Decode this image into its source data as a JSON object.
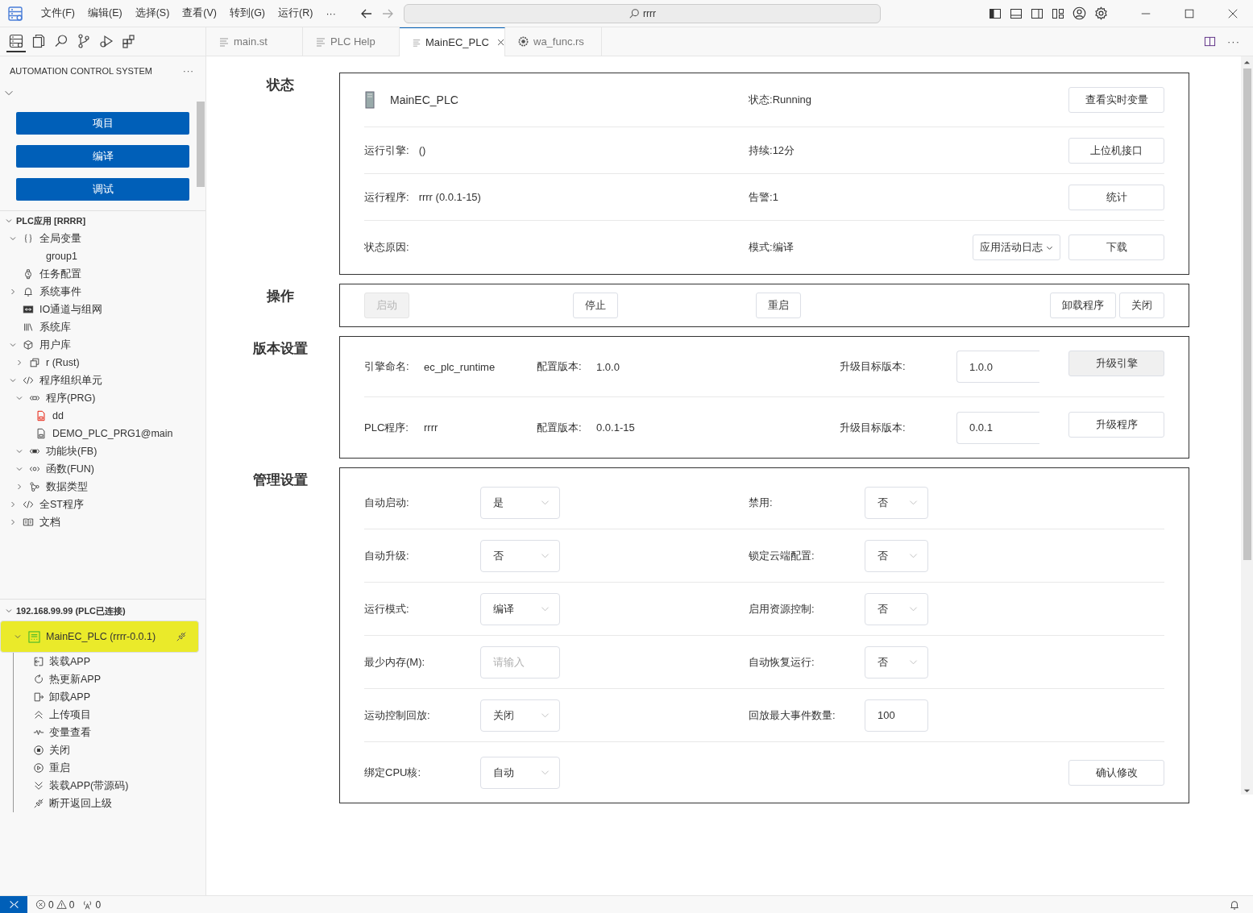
{
  "menu": [
    "文件(F)",
    "编辑(E)",
    "选择(S)",
    "查看(V)",
    "转到(G)",
    "运行(R)",
    "···"
  ],
  "search": {
    "value": "rrrr"
  },
  "activity_bar": [
    {
      "selected": true
    },
    {
      "selected": false
    },
    {
      "selected": false
    },
    {
      "selected": false
    },
    {
      "selected": false
    },
    {
      "selected": false
    }
  ],
  "tabs": [
    {
      "label": "main.st",
      "kind": "text",
      "selected": false
    },
    {
      "label": "PLC Help",
      "kind": "text",
      "selected": false
    },
    {
      "label": "MainEC_PLC",
      "kind": "text",
      "selected": true
    },
    {
      "label": "wa_func.rs",
      "kind": "rust",
      "selected": false
    }
  ],
  "editor_more": "···",
  "sidebar": {
    "title": "AUTOMATION CONTROL SYSTEM",
    "more": "···",
    "buttons": [
      "项目",
      "编译",
      "调试"
    ],
    "project": {
      "label": "PLC应用 [RRRR]",
      "expanded": true,
      "children": [
        {
          "label": "全局变量",
          "kind": "variables",
          "expandable": true,
          "expanded": true,
          "children": [
            {
              "label": "group1",
              "kind": "group",
              "expandable": false,
              "expanded": false
            }
          ]
        },
        {
          "label": "任务配置",
          "kind": "task",
          "expandable": false,
          "expanded": false
        },
        {
          "label": "系统事件",
          "kind": "events",
          "expandable": true,
          "expanded": false
        },
        {
          "label": "IO通道与组网",
          "kind": "io",
          "expandable": false,
          "expanded": false
        },
        {
          "label": "系统库",
          "kind": "library",
          "expandable": false,
          "expanded": false
        },
        {
          "label": "用户库",
          "kind": "package",
          "expandable": true,
          "expanded": true,
          "children": [
            {
              "label": "r (Rust)",
              "kind": "module",
              "expandable": true,
              "expanded": false
            }
          ]
        },
        {
          "label": "程序组织单元",
          "kind": "units",
          "expandable": true,
          "expanded": true,
          "children": [
            {
              "label": "程序(PRG)",
              "kind": "program",
              "expandable": true,
              "expanded": true,
              "children": [
                {
                  "label": "dd",
                  "kind": "ld",
                  "expandable": false,
                  "expanded": false
                },
                {
                  "label": "DEMO_PLC_PRG1@main",
                  "kind": "st",
                  "expandable": false,
                  "expanded": false
                }
              ]
            },
            {
              "label": "功能块(FB)",
              "kind": "fb",
              "expandable": true,
              "expanded": true
            },
            {
              "label": "函数(FUN)",
              "kind": "fc",
              "expandable": true,
              "expanded": true
            },
            {
              "label": "数据类型",
              "kind": "types",
              "expandable": true,
              "expanded": false
            }
          ]
        },
        {
          "label": "全ST程序",
          "kind": "units",
          "expandable": true,
          "expanded": false
        },
        {
          "label": "文档",
          "kind": "docs",
          "expandable": true,
          "expanded": false
        }
      ]
    },
    "connection": {
      "label": "192.168.99.99 (PLC已连接)",
      "expanded": true,
      "device": {
        "label": "MainEC_PLC (rrrr-0.0.1)",
        "selected": true,
        "expanded": true,
        "actions": [
          {
            "label": "装载APP",
            "kind": "load"
          },
          {
            "label": "热更新APP",
            "kind": "hot-update"
          },
          {
            "label": "卸载APP",
            "kind": "unload"
          },
          {
            "label": "上传项目",
            "kind": "upload"
          },
          {
            "label": "变量查看",
            "kind": "watch"
          },
          {
            "label": "关闭",
            "kind": "stop"
          },
          {
            "label": "重启",
            "kind": "restart"
          },
          {
            "label": "装载APP(带源码)",
            "kind": "load-source"
          },
          {
            "label": "断开返回上级",
            "kind": "disconnect"
          }
        ]
      }
    }
  },
  "status_panel": {
    "heading": "状态",
    "rows": [
      {
        "kind": "device",
        "label": "MainEC_PLC",
        "field_label": "状态:",
        "field_value": "Running",
        "buttons": [
          {
            "label": "查看实时变量",
            "kind": "button"
          }
        ]
      },
      {
        "kind": "info",
        "label": "运行引擎:",
        "value": "()",
        "field_label": "持续:",
        "field_value": "12分",
        "buttons": [
          {
            "label": "上位机接口",
            "kind": "button"
          }
        ]
      },
      {
        "kind": "info",
        "label": "运行程序:",
        "value": "rrrr (0.0.1-15)",
        "field_label": "告警:",
        "field_value": "1",
        "buttons": [
          {
            "label": "统计",
            "kind": "button"
          }
        ]
      },
      {
        "kind": "info",
        "label": "状态原因:",
        "field_label": "模式:",
        "field_value": "编译",
        "buttons": [
          {
            "label": "应用活动日志",
            "kind": "dropdown"
          },
          {
            "label": "下载",
            "kind": "button"
          }
        ]
      }
    ]
  },
  "operations": {
    "heading": "操作",
    "buttons": [
      {
        "label": "启动",
        "disabled": true
      },
      {
        "label": "停止",
        "disabled": false
      },
      {
        "label": "重启",
        "disabled": false
      },
      {
        "label": "卸载程序",
        "disabled": false
      },
      {
        "label": "关闭",
        "disabled": false
      }
    ]
  },
  "version_panel": {
    "heading": "版本设置",
    "rows": [
      {
        "name_label": "引擎命名:",
        "name": "ec_plc_runtime",
        "version_label": "配置版本:",
        "version": "1.0.0",
        "target_label": "升级目标版本:",
        "target": "1.0.0",
        "button": "升级引擎",
        "pressed": true
      },
      {
        "name_label": "PLC程序:",
        "name": "rrrr",
        "version_label": "配置版本:",
        "version": "0.0.1-15",
        "target_label": "升级目标版本:",
        "target": "0.0.1",
        "button": "升级程序",
        "pressed": false
      }
    ]
  },
  "management": {
    "heading": "管理设置",
    "rows": [
      {
        "fields": [
          {
            "label": "自动启动:",
            "kind": "select",
            "value": "是"
          },
          {
            "label": "禁用:",
            "kind": "select",
            "value": "否"
          }
        ]
      },
      {
        "fields": [
          {
            "label": "自动升级:",
            "kind": "select",
            "value": "否"
          },
          {
            "label": "锁定云端配置:",
            "kind": "select",
            "value": "否"
          }
        ]
      },
      {
        "fields": [
          {
            "label": "运行模式:",
            "kind": "select",
            "value": "编译"
          },
          {
            "label": "启用资源控制:",
            "kind": "select",
            "value": "否"
          }
        ]
      },
      {
        "fields": [
          {
            "label": "最少内存(M):",
            "kind": "input",
            "placeholder": "请输入"
          },
          {
            "label": "自动恢复运行:",
            "kind": "select",
            "value": "否"
          }
        ]
      },
      {
        "fields": [
          {
            "label": "运动控制回放:",
            "kind": "select",
            "value": "关闭"
          },
          {
            "label": "回放最大事件数量:",
            "kind": "input",
            "value": "100"
          }
        ]
      },
      {
        "fields": [
          {
            "label": "绑定CPU核:",
            "kind": "select",
            "value": "自动"
          }
        ],
        "button": "确认修改"
      }
    ]
  },
  "status_bar": {
    "errors": "0",
    "warnings": "0",
    "ports": "0"
  }
}
